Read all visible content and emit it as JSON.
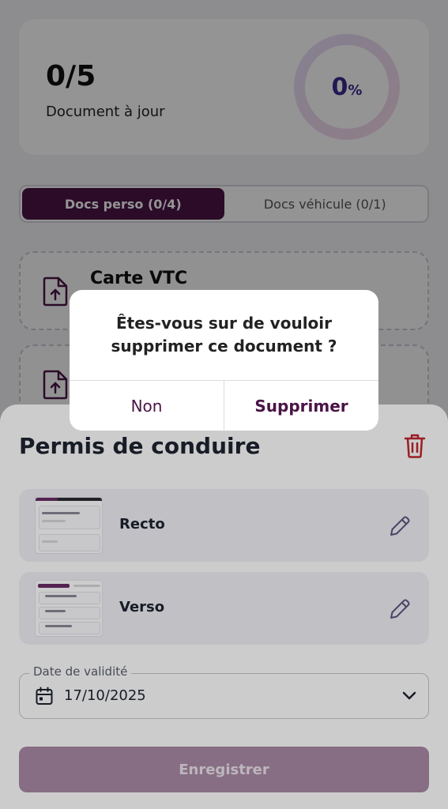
{
  "summary": {
    "count": "0/5",
    "label": "Document à jour",
    "progress_number": "0",
    "progress_unit": "%",
    "progress_fraction": 0
  },
  "tabs": [
    {
      "label": "Docs perso (0/4)",
      "active": true
    },
    {
      "label": "Docs véhicule (0/1)",
      "active": false
    }
  ],
  "documents": [
    {
      "title": "Carte VTC"
    }
  ],
  "sheet": {
    "title": "Permis de conduire",
    "sides": [
      {
        "label": "Recto"
      },
      {
        "label": "Verso"
      }
    ],
    "date_field": {
      "legend": "Date de validité",
      "value": "17/10/2025"
    },
    "save_label": "Enregistrer"
  },
  "alert": {
    "message": "Êtes-vous sur de vouloir supprimer ce document ?",
    "cancel_label": "Non",
    "confirm_label": "Supprimer"
  },
  "colors": {
    "brand": "#4a1446",
    "danger": "#c0262d",
    "disabled_button": "#a98aa6"
  },
  "icons": {
    "upload": "upload-file-icon",
    "trash": "trash-icon",
    "edit": "pencil-icon",
    "calendar": "calendar-icon",
    "chevron": "chevron-down-icon"
  }
}
